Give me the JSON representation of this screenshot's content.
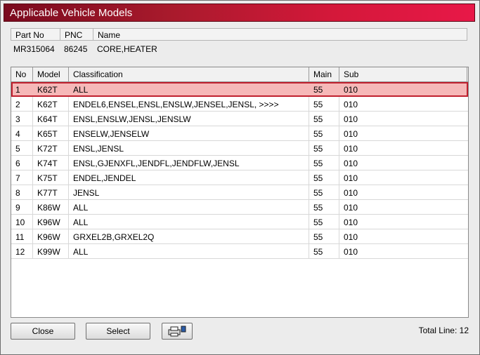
{
  "window": {
    "title": "Applicable Vehicle Models"
  },
  "part_info": {
    "headers": {
      "part_no": "Part No",
      "pnc": "PNC",
      "name": "Name"
    },
    "values": {
      "part_no": "MR315064",
      "pnc": "86245",
      "name": "CORE,HEATER"
    }
  },
  "table": {
    "headers": {
      "no": "No",
      "model": "Model",
      "classification": "Classification",
      "main": "Main",
      "sub": "Sub"
    },
    "rows": [
      {
        "no": "1",
        "model": "K62T",
        "classification": "ALL",
        "main": "55",
        "sub": "010"
      },
      {
        "no": "2",
        "model": "K62T",
        "classification": "ENDEL6,ENSEL,ENSL,ENSLW,JENSEL,JENSL,  >>>>",
        "main": "55",
        "sub": "010"
      },
      {
        "no": "3",
        "model": "K64T",
        "classification": "ENSL,ENSLW,JENSL,JENSLW",
        "main": "55",
        "sub": "010"
      },
      {
        "no": "4",
        "model": "K65T",
        "classification": "ENSELW,JENSELW",
        "main": "55",
        "sub": "010"
      },
      {
        "no": "5",
        "model": "K72T",
        "classification": "ENSL,JENSL",
        "main": "55",
        "sub": "010"
      },
      {
        "no": "6",
        "model": "K74T",
        "classification": "ENSL,GJENXFL,JENDFL,JENDFLW,JENSL",
        "main": "55",
        "sub": "010"
      },
      {
        "no": "7",
        "model": "K75T",
        "classification": "ENDEL,JENDEL",
        "main": "55",
        "sub": "010"
      },
      {
        "no": "8",
        "model": "K77T",
        "classification": "JENSL",
        "main": "55",
        "sub": "010"
      },
      {
        "no": "9",
        "model": "K86W",
        "classification": "ALL",
        "main": "55",
        "sub": "010"
      },
      {
        "no": "10",
        "model": "K96W",
        "classification": "ALL",
        "main": "55",
        "sub": "010"
      },
      {
        "no": "11",
        "model": "K96W",
        "classification": "GRXEL2B,GRXEL2Q",
        "main": "55",
        "sub": "010"
      },
      {
        "no": "12",
        "model": "K99W",
        "classification": "ALL",
        "main": "55",
        "sub": "010"
      }
    ]
  },
  "buttons": {
    "close": "Close",
    "select": "Select",
    "print_icon": "printer-icon"
  },
  "footer": {
    "total_line": "Total Line: 12"
  },
  "colors": {
    "title_bar": "#c0183a",
    "selected_row": "#f6b8b8",
    "selected_border": "#c0202e"
  }
}
